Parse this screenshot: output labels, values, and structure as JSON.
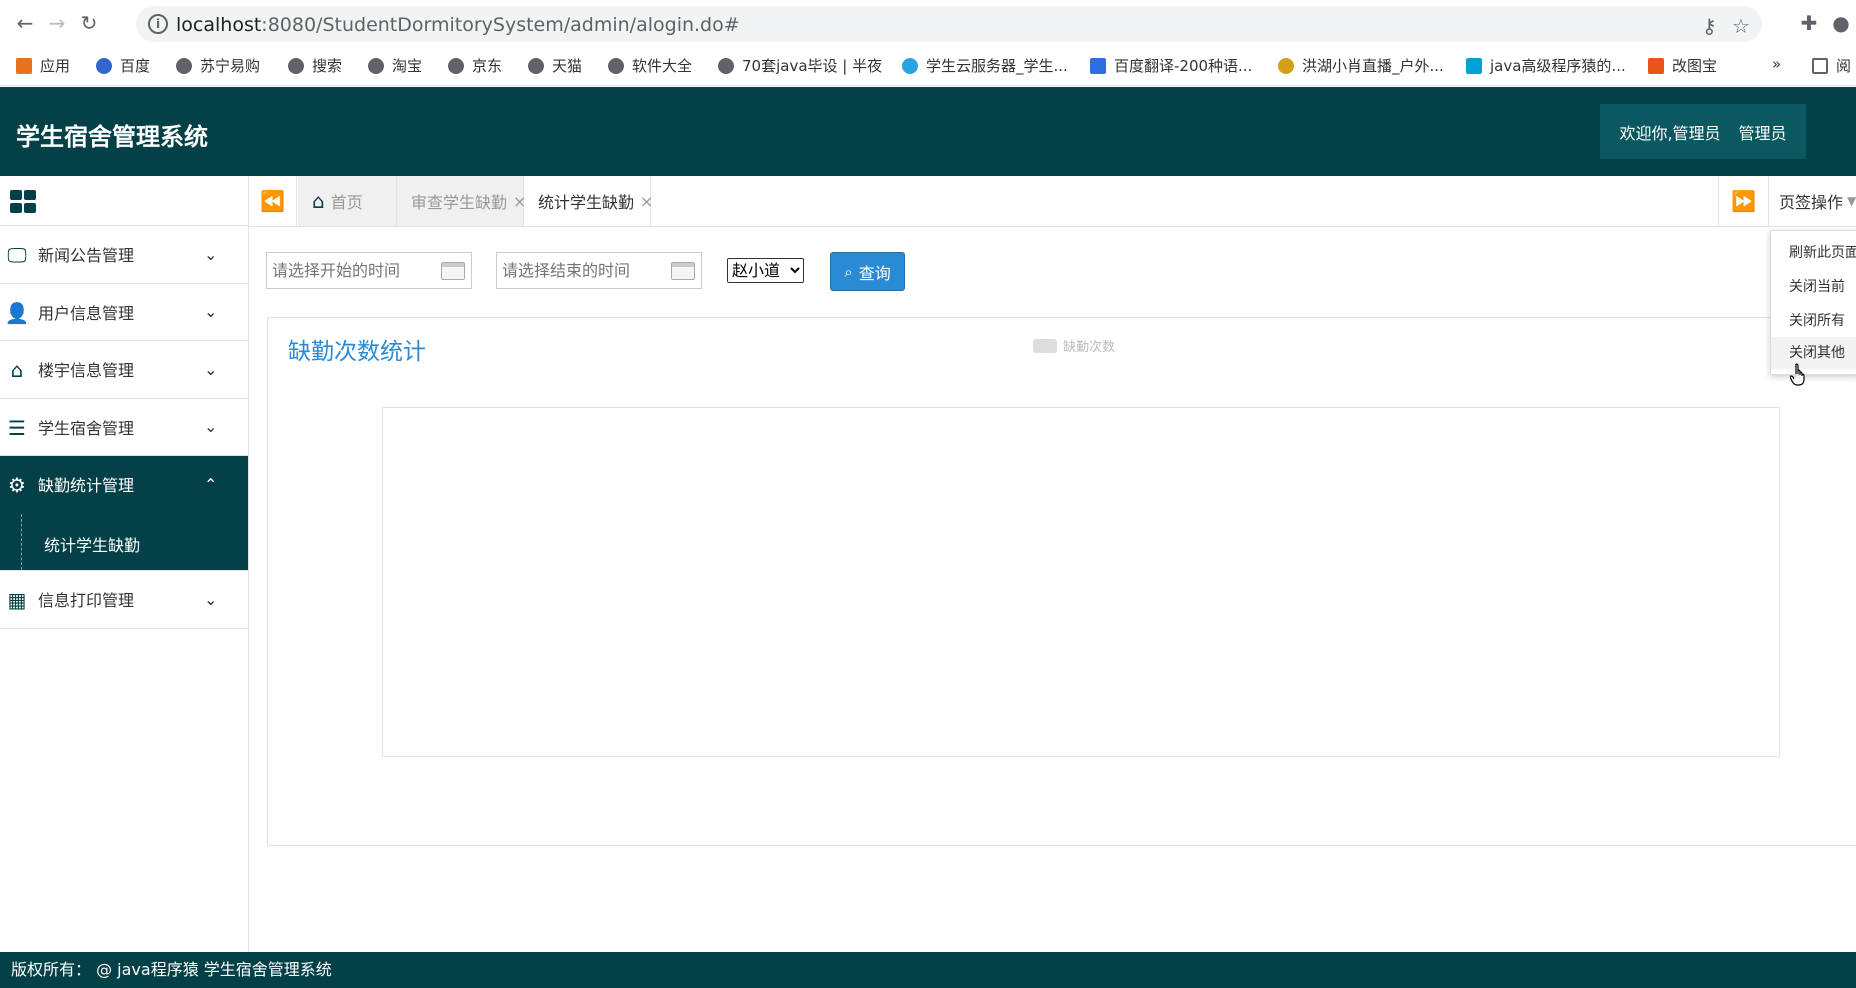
{
  "browser": {
    "url_host": "localhost",
    "url_rest": ":8080/StudentDormitorySystem/admin/alogin.do#",
    "bookmarks": [
      "应用",
      "百度",
      "苏宁易购",
      "搜索",
      "淘宝",
      "京东",
      "天猫",
      "软件大全",
      "70套java毕设 | 半夜",
      "学生云服务器_学生...",
      "百度翻译-200种语...",
      "洪湖小肖直播_户外...",
      "java高级程序猿的...",
      "改图宝"
    ],
    "more": "»",
    "reading": "阅"
  },
  "header": {
    "title": "学生宿舍管理系统",
    "welcome": "欢迎你,管理员",
    "role": "管理员"
  },
  "sidebar": {
    "items": [
      {
        "label": "新闻公告管理",
        "icon": "monitor-icon"
      },
      {
        "label": "用户信息管理",
        "icon": "user-icon"
      },
      {
        "label": "楼宇信息管理",
        "icon": "home-icon"
      },
      {
        "label": "学生宿舍管理",
        "icon": "database-icon"
      },
      {
        "label": "缺勤统计管理",
        "icon": "gears-icon"
      },
      {
        "label": "信息打印管理",
        "icon": "film-icon"
      }
    ],
    "sub_item": "统计学生缺勤"
  },
  "tabs": {
    "home": "首页",
    "review": "审查学生缺勤",
    "current": "统计学生缺勤",
    "ops": "页签操作"
  },
  "filter": {
    "start_placeholder": "请选择开始的时间",
    "end_placeholder": "请选择结束的时间",
    "student": "赵小道",
    "query_label": "查询"
  },
  "chart": {
    "title": "缺勤次数统计",
    "legend": "缺勤次数"
  },
  "dropdown": {
    "items": [
      "刷新此页面",
      "关闭当前",
      "关闭所有",
      "关闭其他"
    ]
  },
  "footer": {
    "text": "版权所有： @ java程序猿 学生宿舍管理系统"
  },
  "colors": {
    "primary": "#044047",
    "accent": "#2a8bd4"
  }
}
